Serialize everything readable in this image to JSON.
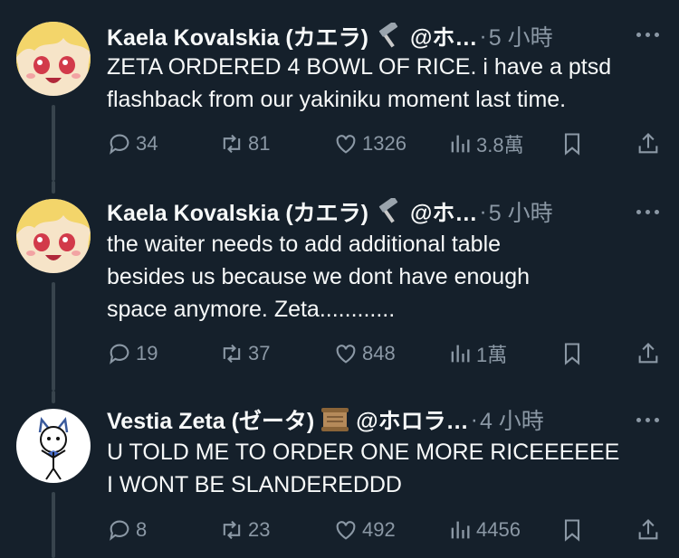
{
  "tweets": [
    {
      "name": "Kaela Kovalskia (カエラ)",
      "badge_icon": "hammer-icon",
      "handle": "@ホ…",
      "sep": "·",
      "time": "5 小時",
      "text_lines": [
        "ZETA ORDERED 4 BOWL OF RICE. i have a ptsd",
        "flashback from our yakiniku moment last time."
      ],
      "replies": "34",
      "retweets": "81",
      "likes": "1326",
      "views": "3.8萬"
    },
    {
      "name": "Kaela Kovalskia (カエラ)",
      "badge_icon": "hammer-icon",
      "handle": "@ホ…",
      "sep": "·",
      "time": "5 小時",
      "text_lines": [
        "the waiter needs to add additional table",
        "besides us because we dont have enough",
        "space anymore. Zeta............"
      ],
      "replies": "19",
      "retweets": "37",
      "likes": "848",
      "views": "1萬"
    },
    {
      "name": "Vestia Zeta (ゼータ)",
      "badge_icon": "scroll-icon",
      "handle": "@ホロラ…",
      "sep": "·",
      "time": "4 小時",
      "text_lines": [
        "U TOLD ME TO ORDER ONE MORE RICEEEEEE",
        "I WONT BE SLANDEREDDD"
      ],
      "replies": "8",
      "retweets": "23",
      "likes": "492",
      "views": "4456"
    }
  ],
  "colors": {
    "background": "#15202b",
    "text": "#f7f9f9",
    "secondary": "#8b98a5",
    "line": "#38444d"
  }
}
